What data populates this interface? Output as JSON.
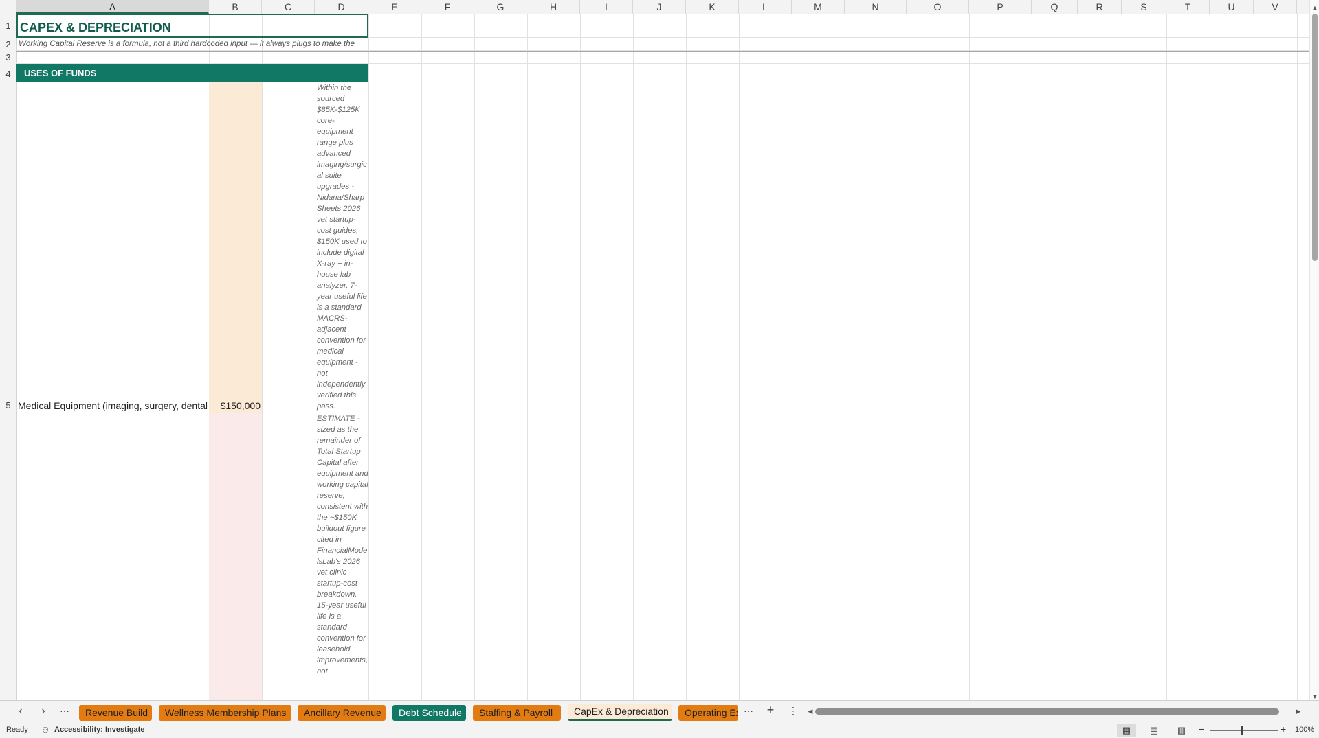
{
  "columns": [
    "A",
    "B",
    "C",
    "D",
    "E",
    "F",
    "G",
    "H",
    "I",
    "J",
    "K",
    "L",
    "M",
    "N",
    "O",
    "P",
    "Q",
    "R",
    "S",
    "T",
    "U",
    "V"
  ],
  "rows": [
    "1",
    "2",
    "3",
    "4",
    "5"
  ],
  "sheet": {
    "title": "CAPEX & DEPRECIATION",
    "subtitle": "Working Capital Reserve is a formula, not a third hardcoded input — it always plugs to make the",
    "section_banner": "USES OF FUNDS",
    "row5": {
      "label": "Medical Equipment (imaging, surgery, dental",
      "value": "$150,000",
      "note": "Within the sourced $85K-$125K core-equipment range plus advanced imaging/surgical suite upgrades - Nidana/Sharp Sheets 2026 vet startup-cost guides; $150K used to include digital X-ray + in-house lab analyzer. 7-year useful life is a standard MACRS-adjacent convention for medical equipment - not independently verified this pass."
    },
    "row6": {
      "note": "ESTIMATE - sized as the remainder of Total Startup Capital after equipment and working capital reserve; consistent with the ~$150K buildout figure cited in FinancialModelsLab's 2026 vet clinic startup-cost breakdown. 15-year useful life is a standard convention for leasehold improvements, not"
    }
  },
  "tabs": [
    {
      "label": "Revenue Build",
      "style": "orange"
    },
    {
      "label": "Wellness Membership Plans",
      "style": "orange"
    },
    {
      "label": "Ancillary Revenue",
      "style": "orange"
    },
    {
      "label": "Debt Schedule",
      "style": "teal"
    },
    {
      "label": "Staffing & Payroll",
      "style": "orange"
    },
    {
      "label": "CapEx & Depreciation",
      "style": "active"
    },
    {
      "label": "Operating Ex",
      "style": "orange"
    }
  ],
  "status": {
    "ready": "Ready",
    "accessibility": "Accessibility: Investigate",
    "zoom": "100%"
  },
  "colors": {
    "teal": "#117865",
    "orange": "#e27b12",
    "input_fill": "#fbebd6",
    "pink_fill": "#fbeaea"
  }
}
